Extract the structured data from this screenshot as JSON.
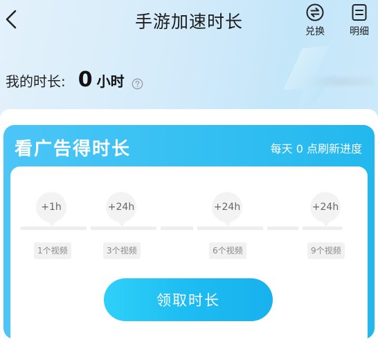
{
  "header": {
    "title": "手游加速时长",
    "actions": [
      {
        "label": "兑换",
        "icon": "exchange-icon"
      },
      {
        "label": "明细",
        "icon": "document-icon"
      }
    ]
  },
  "summary": {
    "label": "我的时长:",
    "value": "0",
    "unit": "小时"
  },
  "ad_task": {
    "title": "看广告得时长",
    "subtitle": "每天 0 点刷新进度",
    "milestones": [
      {
        "reward": "+1h",
        "requirement": "1个视频"
      },
      {
        "reward": "+24h",
        "requirement": "3个视频"
      },
      {
        "reward": "+24h",
        "requirement": "6个视频"
      },
      {
        "reward": "+24h",
        "requirement": "9个视频"
      }
    ],
    "progress": 0,
    "button_label": "领取时长"
  },
  "colors": {
    "accent": "#1dbcf2",
    "card": "#36c0f2",
    "header_bg": "#d6ecfa"
  }
}
